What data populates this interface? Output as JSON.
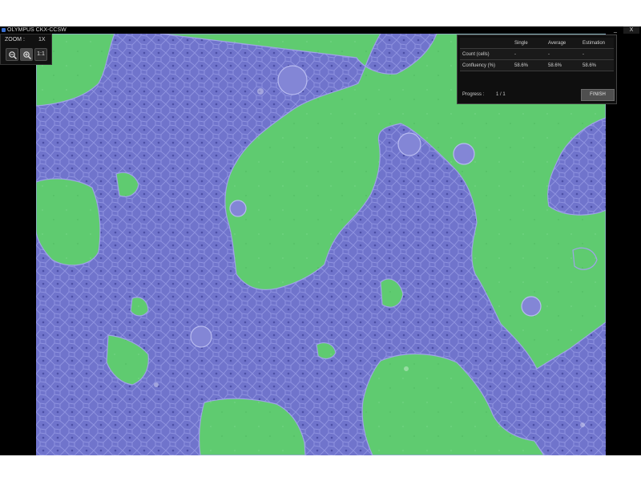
{
  "window": {
    "title": "OLYMPUS CKX-CCSW",
    "minimize_label": "_",
    "close_label": "X"
  },
  "zoom": {
    "label": "ZOOM :",
    "value": "1X",
    "zoom_out_icon": "zoom-out-magnifier",
    "zoom_in_icon": "zoom-in-magnifier",
    "actual_size_label": "1:1"
  },
  "results": {
    "columns": [
      "",
      "Single",
      "Average",
      "Estimation"
    ],
    "rows": [
      {
        "label": "Count (cells)",
        "values": [
          "-",
          "-",
          "-"
        ]
      },
      {
        "label": "Confluency (%)",
        "values": [
          "58.6%",
          "58.6%",
          "58.6%"
        ]
      }
    ],
    "progress_label": "Progress :",
    "progress_value": "1  /  1",
    "finish_label": "FINISH"
  },
  "colors": {
    "cell_overlay": "#6f73cf",
    "background_overlay": "#5fcb70",
    "panel_bg": "#0f0f0f"
  }
}
